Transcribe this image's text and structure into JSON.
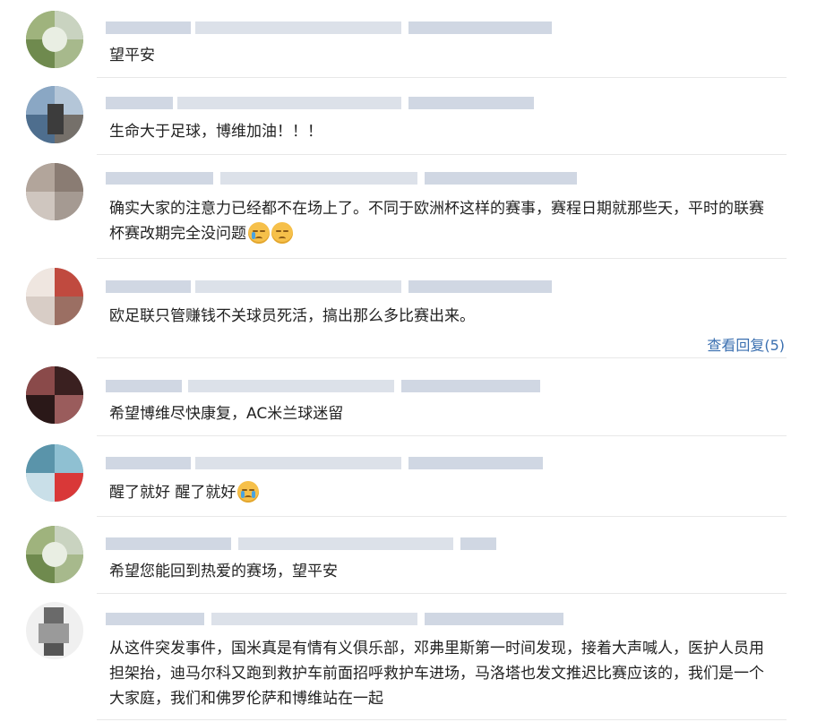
{
  "comments": [
    {
      "text": "望平安",
      "emoji": []
    },
    {
      "text": "生命大于足球，博维加油！！！",
      "emoji": []
    },
    {
      "text_lines": [
        "确实大家的注意力已经都不在场上了。不同于欧洲杯这样的赛事，赛程日期就那些天，平时的联赛",
        "杯赛改期完全没问题"
      ],
      "emoji": [
        "crying-face-icon",
        "sad-face-icon"
      ]
    },
    {
      "text": "欧足联只管赚钱不关球员死活，搞出那么多比赛出来。",
      "emoji": [],
      "reply_link": "查看回复(5)"
    },
    {
      "text": "希望博维尽快康复，AC米兰球迷留",
      "emoji": []
    },
    {
      "text": "醒了就好 醒了就好",
      "emoji": [
        "loudly-crying-face-icon"
      ]
    },
    {
      "text": "希望您能回到热爱的赛场，望平安",
      "emoji": []
    },
    {
      "text_lines": [
        "从这件突发事件，国米真是有情有义俱乐部，邓弗里斯第一时间发现，接着大声喊人，医护人员用",
        "担架抬，迪马尔科又跑到救护车前面招呼救护车进场，马洛塔也发文推迟比赛应该的，我们是一个",
        "大家庭，我们和佛罗伦萨和博维站在一起"
      ],
      "emoji": []
    }
  ],
  "colors": {
    "link": "#3a6fb0",
    "separator": "#e8e8e8",
    "text": "#222222"
  }
}
